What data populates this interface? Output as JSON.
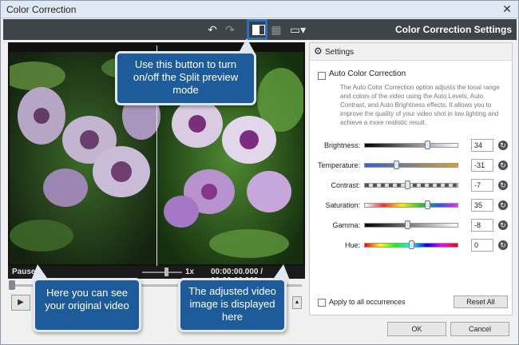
{
  "window": {
    "title": "Color Correction",
    "close_glyph": "✕"
  },
  "toolbar": {
    "undo_glyph": "↶",
    "redo_glyph": "↷",
    "grid_glyph": "▦",
    "monitor_glyph": "▭▾",
    "settings_title": "Color Correction Settings",
    "icons": [
      "undo-icon",
      "redo-icon",
      "split-preview-icon",
      "grid-icon",
      "monitor-icon"
    ]
  },
  "preview": {
    "status": "Paused",
    "zoom": "1x",
    "time": "00:00:00.000 / 00:00:03.960",
    "seek_position": 0.0,
    "play_glyph": "▶",
    "volume_glyph": "▲"
  },
  "settings": {
    "header": "Settings",
    "gear_glyph": "⚙",
    "auto_correction": {
      "label": "Auto Color Correction",
      "checked": false,
      "description": "The Auto Color Correction option adjusts the tonal range and colors of the video using the Auto Levels, Auto Contrast, and Auto Brightness effects. It allows you to improve the quality of your video shot in low lighting and achieve a more realistic result."
    },
    "sliders": [
      {
        "label": "Brightness:",
        "value": "34",
        "position": 0.67
      },
      {
        "label": "Temperature:",
        "value": "-31",
        "position": 0.34
      },
      {
        "label": "Contrast:",
        "value": "-7",
        "position": 0.46
      },
      {
        "label": "Saturation:",
        "value": "35",
        "position": 0.67
      },
      {
        "label": "Gamma:",
        "value": "-8",
        "position": 0.46
      },
      {
        "label": "Hue:",
        "value": "0",
        "position": 0.5
      }
    ],
    "reset_glyph": "↻",
    "apply_all": {
      "label": "Apply to all occurrences",
      "checked": false
    },
    "reset_all": "Reset All"
  },
  "footer": {
    "ok": "OK",
    "cancel": "Cancel"
  },
  "callouts": {
    "split": "Use this button to turn on/off the Split preview mode",
    "original": "Here you can see your original video",
    "adjusted": "The adjusted video image is displayed here"
  },
  "colors": {
    "toolbar_bg": "#3f4448",
    "callout_bg": "#1d5b9b",
    "accent": "#2b6fc0"
  }
}
